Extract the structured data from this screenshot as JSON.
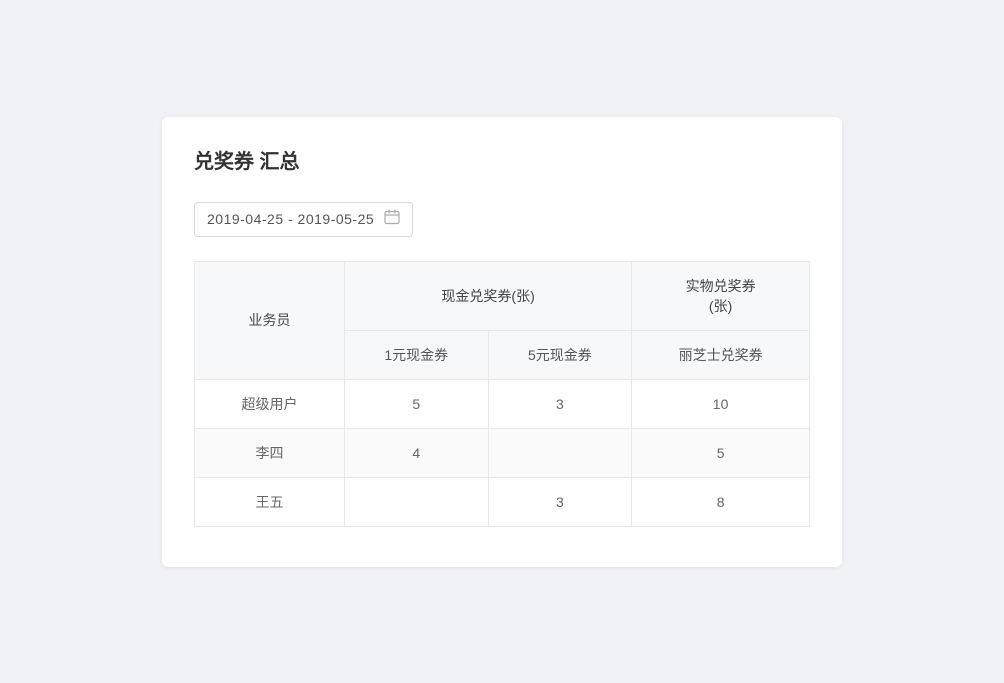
{
  "title": "兑奖券 汇总",
  "datePicker": {
    "value": "2019-04-25 - 2019-05-25",
    "icon": "📅"
  },
  "table": {
    "colGroups": [
      {
        "label": "业务员",
        "rowspan": 2,
        "colspan": 1
      },
      {
        "label": "现金兑奖券(张)",
        "rowspan": 1,
        "colspan": 2
      },
      {
        "label": "实物兑奖券\n(张)",
        "rowspan": 1,
        "colspan": 1
      }
    ],
    "subHeaders": [
      {
        "label": "1元现金券"
      },
      {
        "label": "5元现金券"
      },
      {
        "label": "丽芝士兑奖券"
      }
    ],
    "rows": [
      {
        "salesperson": "超级用户",
        "cash1": "5",
        "cash5": "3",
        "lizhishi": "10"
      },
      {
        "salesperson": "李四",
        "cash1": "4",
        "cash5": "",
        "lizhishi": "5"
      },
      {
        "salesperson": "王五",
        "cash1": "",
        "cash5": "3",
        "lizhishi": "8"
      }
    ]
  }
}
